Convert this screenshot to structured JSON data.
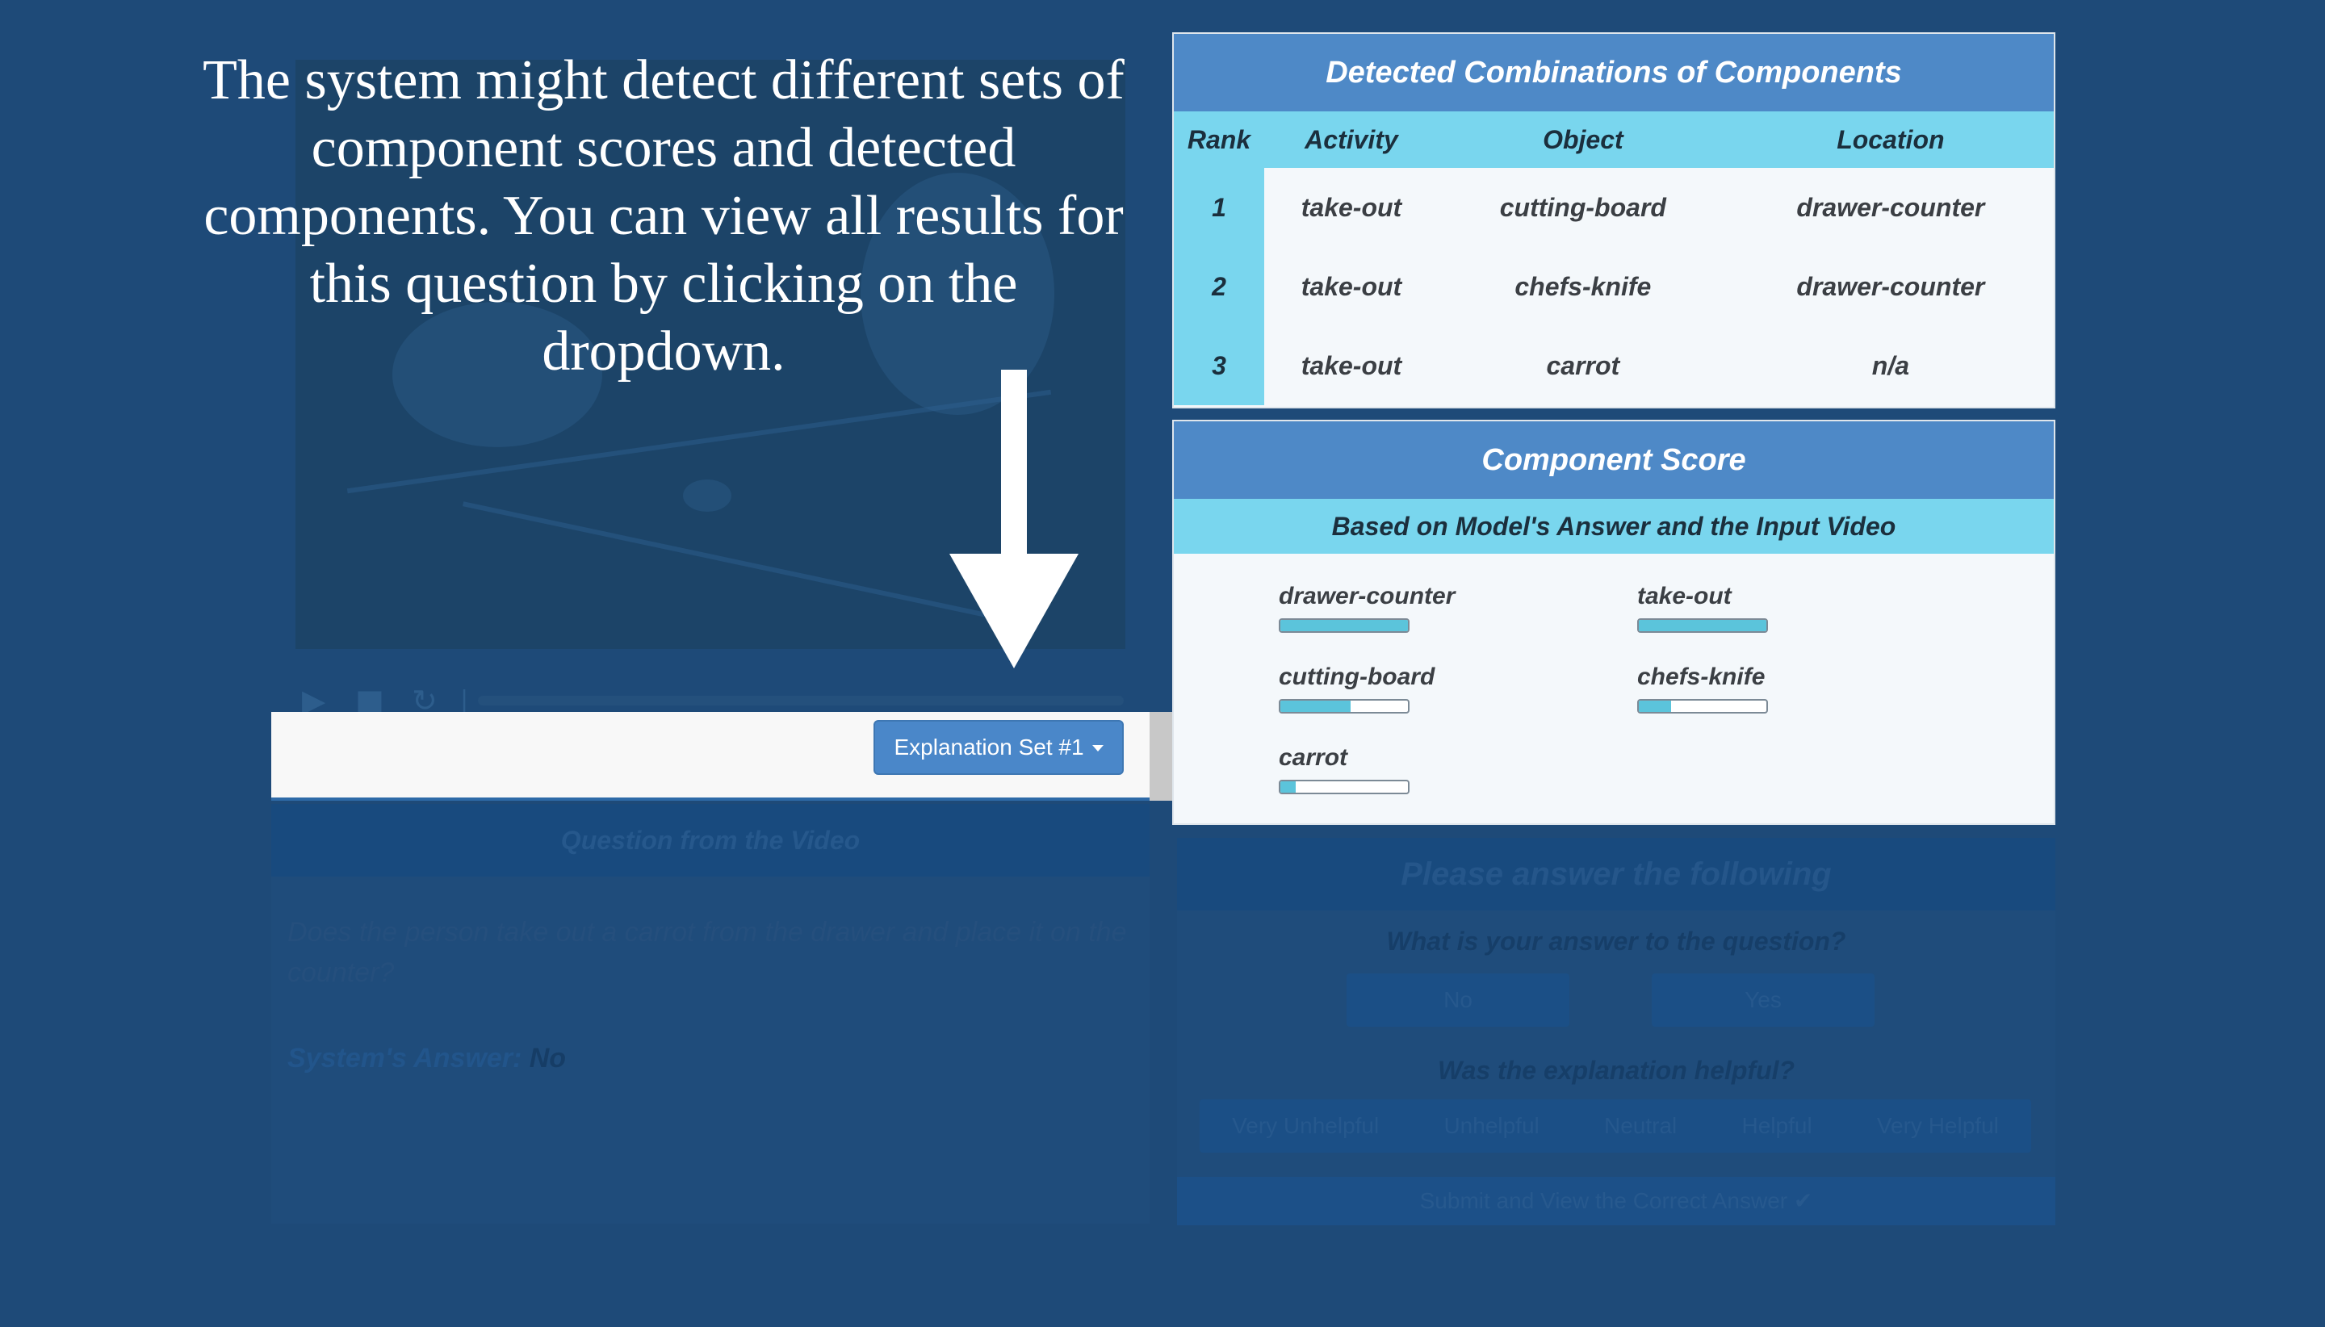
{
  "tutorial": {
    "text": "The system might detect different sets of component scores and detected components. You can view all results for this question by clicking on the dropdown."
  },
  "toolbar": {
    "dropdown_label": "Explanation Set #1"
  },
  "question": {
    "heading": "Question from the Video",
    "text": "Does the person take out a carrot from the drawer and place it on the counter?",
    "system_answer_label": "System's Answer:",
    "system_answer_value": "No"
  },
  "answer_form": {
    "heading": "Please answer the following",
    "question1": "What is your answer to the question?",
    "options1": [
      "No",
      "Yes"
    ],
    "question2": "Was the explanation helpful?",
    "options2": [
      "Very Unhelpful",
      "Unhelpful",
      "Neutral",
      "Helpful",
      "Very Helpful"
    ],
    "submit_label": "Submit and View the Correct Answer"
  },
  "combinations": {
    "title": "Detected Combinations of Components",
    "headers": [
      "Rank",
      "Activity",
      "Object",
      "Location"
    ],
    "rows": [
      [
        "1",
        "take-out",
        "cutting-board",
        "drawer-counter"
      ],
      [
        "2",
        "take-out",
        "chefs-knife",
        "drawer-counter"
      ],
      [
        "3",
        "take-out",
        "carrot",
        "n/a"
      ]
    ]
  },
  "component_score": {
    "title": "Component Score",
    "subtitle": "Based on Model's Answer and the Input Video",
    "items": [
      {
        "label": "drawer-counter",
        "value": 1.0
      },
      {
        "label": "take-out",
        "value": 1.0
      },
      {
        "label": "cutting-board",
        "value": 0.55
      },
      {
        "label": "chefs-knife",
        "value": 0.25
      },
      {
        "label": "carrot",
        "value": 0.12
      }
    ]
  },
  "colors": {
    "page_bg": "#1e4a78",
    "panel_header": "#4e89c7",
    "table_accent": "#79d6ee",
    "bar_fill": "#5bc4db",
    "dropdown_button": "#4a87c9"
  }
}
